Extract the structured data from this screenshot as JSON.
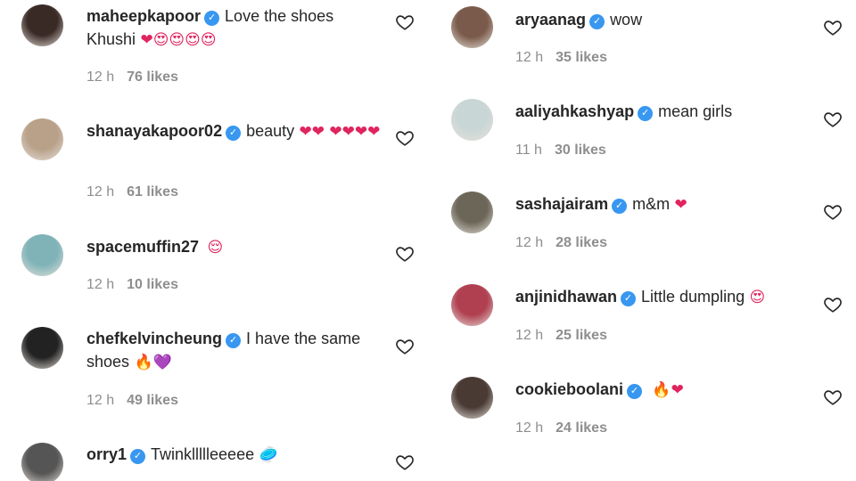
{
  "left": [
    {
      "user": "maheepkapoor",
      "verified": true,
      "text": "Love the shoes Khushi",
      "emoji": "❤😍😍😍😍",
      "time": "12 h",
      "likes": "76 likes",
      "avatar_color": "#3a2a26"
    },
    {
      "user": "shanayakapoor02",
      "verified": true,
      "text": "beauty",
      "emoji": "❤❤ ❤❤❤❤",
      "time": "12 h",
      "likes": "61 likes",
      "avatar_color": "#b8a089"
    },
    {
      "user": "spacemuffin27",
      "verified": false,
      "text": "",
      "emoji": "😌",
      "time": "12 h",
      "likes": "10 likes",
      "avatar_color": "#7fb3b8"
    },
    {
      "user": "chefkelvincheung",
      "verified": true,
      "text": "I have the same shoes",
      "emoji": "🔥💜",
      "time": "12 h",
      "likes": "49 likes",
      "avatar_color": "#222222"
    },
    {
      "user": "orry1",
      "verified": true,
      "text": "Twinkllllleeeee",
      "emoji": "🥏",
      "time": "",
      "likes": "",
      "avatar_color": "#555555"
    }
  ],
  "right": [
    {
      "user": "aryaanag",
      "verified": true,
      "text": "wow",
      "emoji": "",
      "time": "12 h",
      "likes": "35 likes",
      "avatar_color": "#7a5a4a"
    },
    {
      "user": "aaliyahkashyap",
      "verified": true,
      "text": "mean girls",
      "emoji": "",
      "time": "11 h",
      "likes": "30 likes",
      "avatar_color": "#c9d6d6"
    },
    {
      "user": "sashajairam",
      "verified": true,
      "text": "m&m",
      "emoji": "❤",
      "time": "12 h",
      "likes": "28 likes",
      "avatar_color": "#6b6658"
    },
    {
      "user": "anjinidhawan",
      "verified": true,
      "text": "Little dumpling",
      "emoji": "😍",
      "time": "12 h",
      "likes": "25 likes",
      "avatar_color": "#b04050"
    },
    {
      "user": "cookieboolani",
      "verified": true,
      "text": "",
      "emoji": "🔥❤",
      "time": "12 h",
      "likes": "24 likes",
      "avatar_color": "#4a3a34"
    }
  ],
  "icons": {
    "heart": "heart-outline-icon",
    "verified": "verified-badge-icon"
  },
  "colors": {
    "verified_blue": "#3897f0",
    "meta_gray": "#8e8e8e"
  }
}
